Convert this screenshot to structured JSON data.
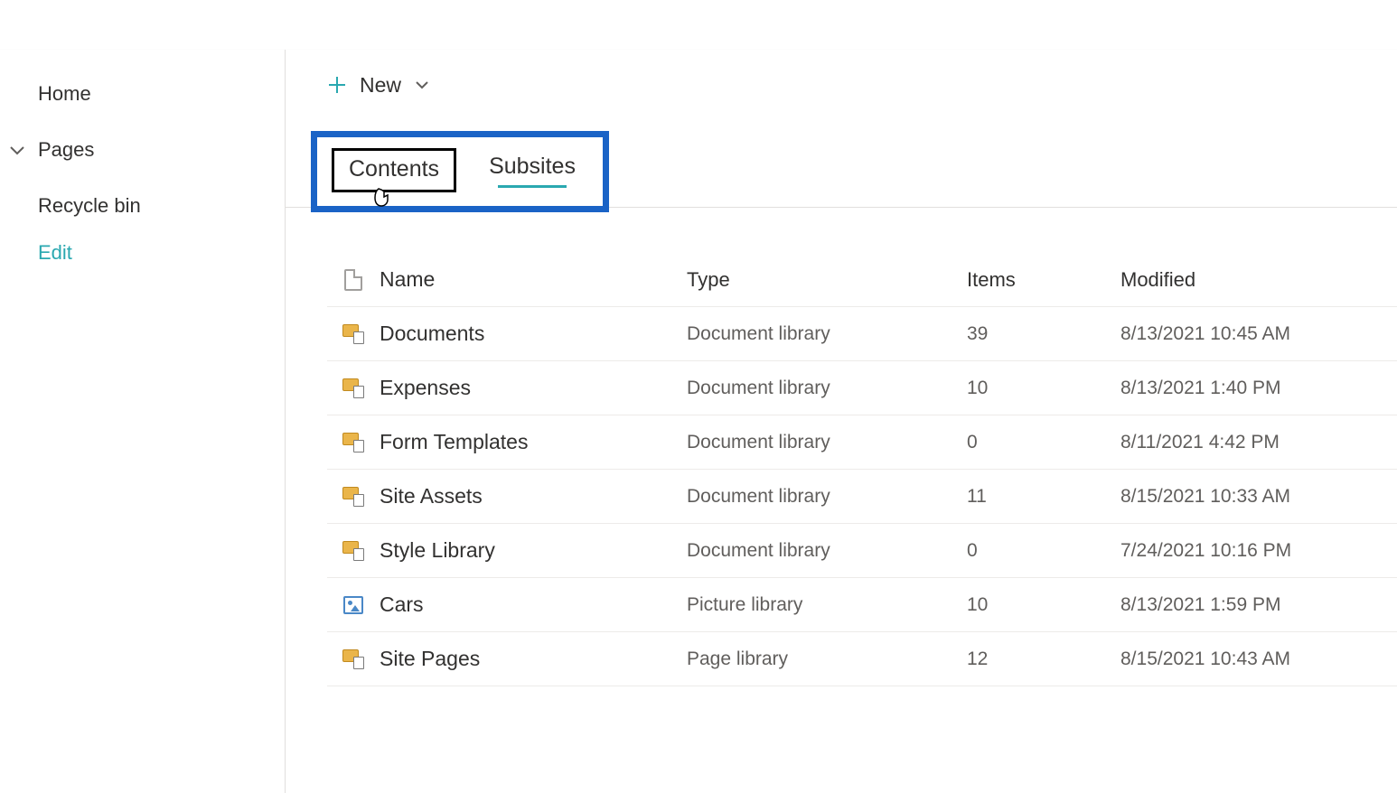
{
  "sidebar": {
    "items": [
      {
        "label": "Home"
      },
      {
        "label": "Pages",
        "expandable": true
      },
      {
        "label": "Recycle bin"
      }
    ],
    "edit_label": "Edit"
  },
  "toolbar": {
    "new_label": "New"
  },
  "tabs": {
    "contents": "Contents",
    "subsites": "Subsites"
  },
  "table": {
    "headers": {
      "name": "Name",
      "type": "Type",
      "items": "Items",
      "modified": "Modified"
    },
    "rows": [
      {
        "icon": "doclib",
        "name": "Documents",
        "type": "Document library",
        "items": "39",
        "modified": "8/13/2021 10:45 AM"
      },
      {
        "icon": "doclib",
        "name": "Expenses",
        "type": "Document library",
        "items": "10",
        "modified": "8/13/2021 1:40 PM"
      },
      {
        "icon": "doclib",
        "name": "Form Templates",
        "type": "Document library",
        "items": "0",
        "modified": "8/11/2021 4:42 PM"
      },
      {
        "icon": "doclib",
        "name": "Site Assets",
        "type": "Document library",
        "items": "11",
        "modified": "8/15/2021 10:33 AM"
      },
      {
        "icon": "doclib",
        "name": "Style Library",
        "type": "Document library",
        "items": "0",
        "modified": "7/24/2021 10:16 PM"
      },
      {
        "icon": "piclib",
        "name": "Cars",
        "type": "Picture library",
        "items": "10",
        "modified": "8/13/2021 1:59 PM"
      },
      {
        "icon": "doclib",
        "name": "Site Pages",
        "type": "Page library",
        "items": "12",
        "modified": "8/15/2021 10:43 AM"
      }
    ]
  }
}
